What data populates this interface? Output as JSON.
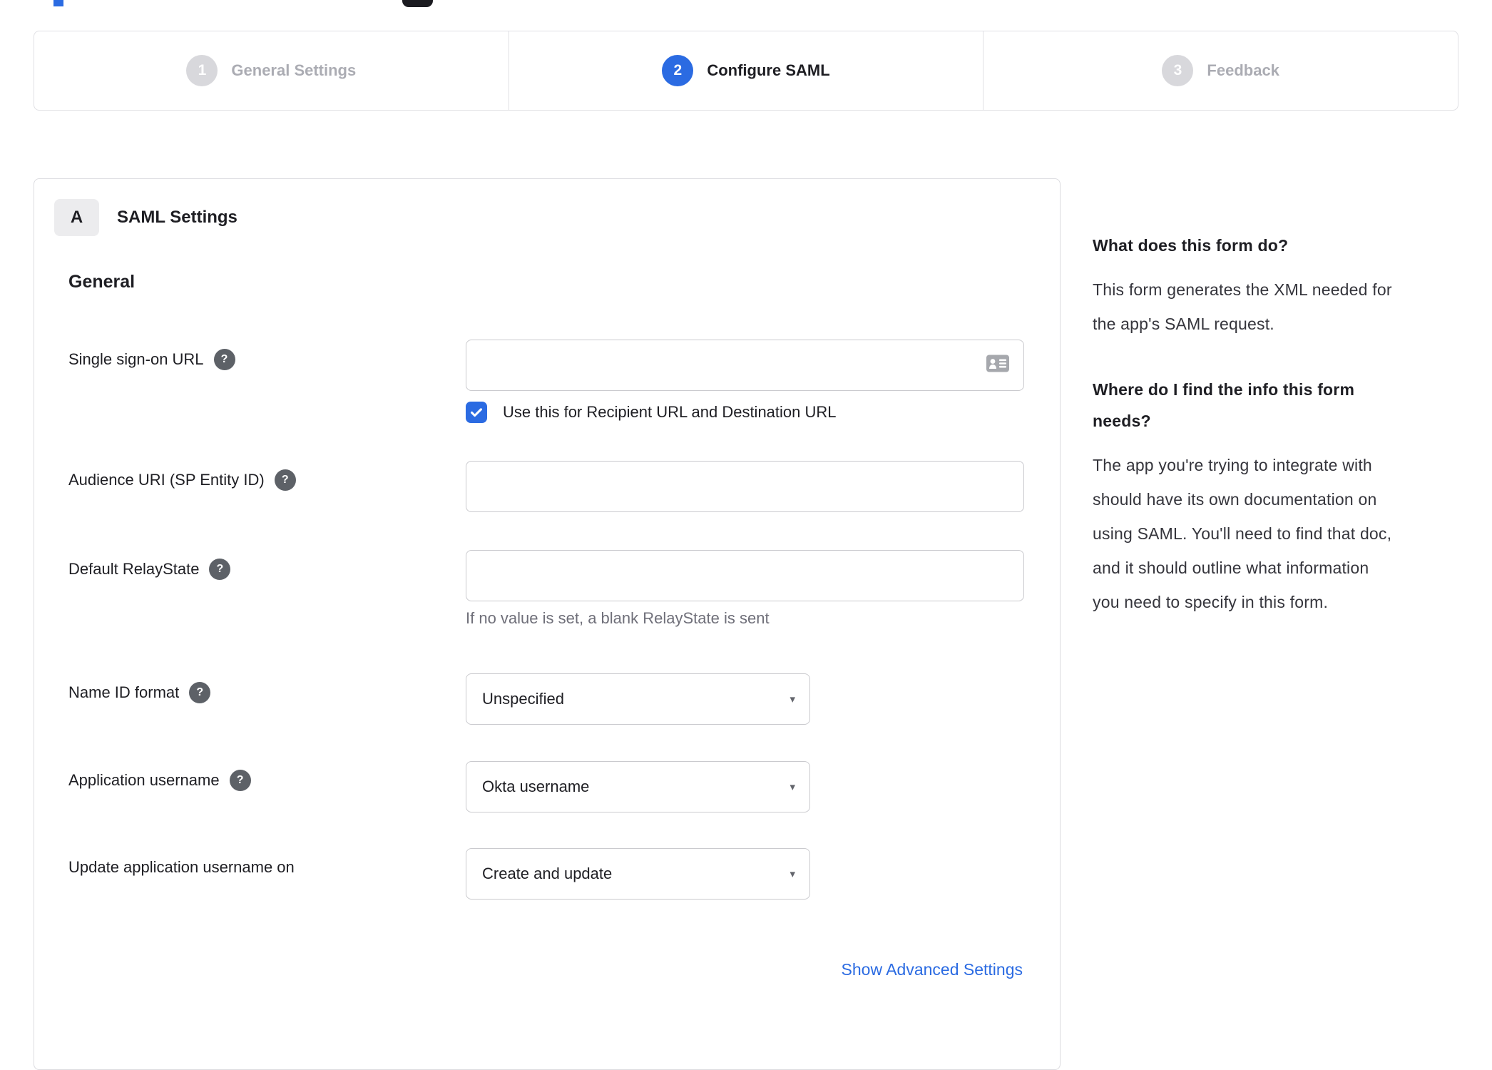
{
  "stepper": {
    "steps": [
      {
        "number": "1",
        "label": "General Settings",
        "state": "inactive"
      },
      {
        "number": "2",
        "label": "Configure SAML",
        "state": "active"
      },
      {
        "number": "3",
        "label": "Feedback",
        "state": "inactive"
      }
    ]
  },
  "panel": {
    "badge": "A",
    "title": "SAML Settings",
    "section_heading": "General",
    "advanced_settings_link": "Show Advanced Settings"
  },
  "form": {
    "sso_url": {
      "label": "Single sign-on URL",
      "value": "",
      "checkbox": {
        "checked": true,
        "label": "Use this for Recipient URL and Destination URL"
      }
    },
    "audience_uri": {
      "label": "Audience URI (SP Entity ID)",
      "value": ""
    },
    "default_relaystate": {
      "label": "Default RelayState",
      "value": "",
      "helper": "If no value is set, a blank RelayState is sent"
    },
    "name_id_format": {
      "label": "Name ID format",
      "value": "Unspecified"
    },
    "application_username": {
      "label": "Application username",
      "value": "Okta username"
    },
    "update_application_username": {
      "label": "Update application username on",
      "value": "Create and update"
    }
  },
  "sidebar": {
    "sections": [
      {
        "heading": "What does this form do?",
        "body": "This form generates the XML needed for the app's SAML request."
      },
      {
        "heading": "Where do I find the info this form needs?",
        "body": "The app you're trying to integrate with should have its own documentation on using SAML. You'll need to find that doc, and it should outline what information you need to specify in this form."
      }
    ]
  },
  "icons": {
    "help": "?",
    "dropdown_caret": "▾"
  },
  "colors": {
    "accent_blue": "#2b6be2",
    "inactive_gray": "#d8d8dc",
    "text_dark": "#1e1e23",
    "muted_text": "#6f6f79",
    "border": "#dcdce0"
  }
}
